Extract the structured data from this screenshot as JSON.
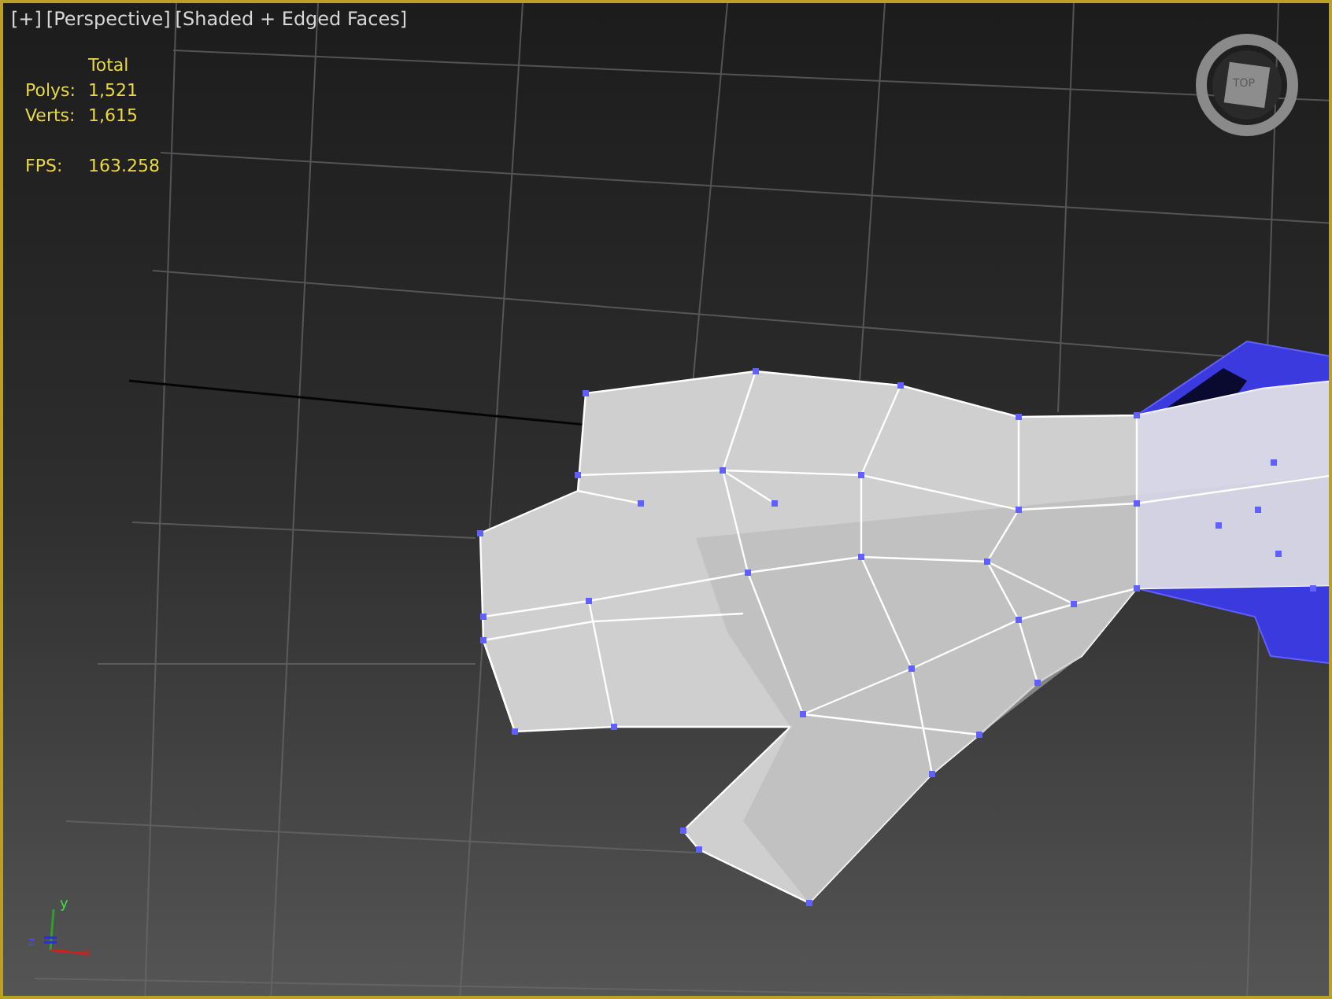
{
  "viewport": {
    "labels": [
      "[+]",
      "[Perspective]",
      "[Shaded + Edged Faces]"
    ],
    "active": true
  },
  "statistics": {
    "header": "Total",
    "rows": [
      {
        "label": "Polys:",
        "value": "1,521"
      },
      {
        "label": "Verts:",
        "value": "1,615"
      }
    ],
    "fps": {
      "label": "FPS:",
      "value": "163.258"
    }
  },
  "viewcube": {
    "face": "TOP"
  },
  "axis_tripod": {
    "x": "x",
    "y": "y",
    "z": "z"
  }
}
